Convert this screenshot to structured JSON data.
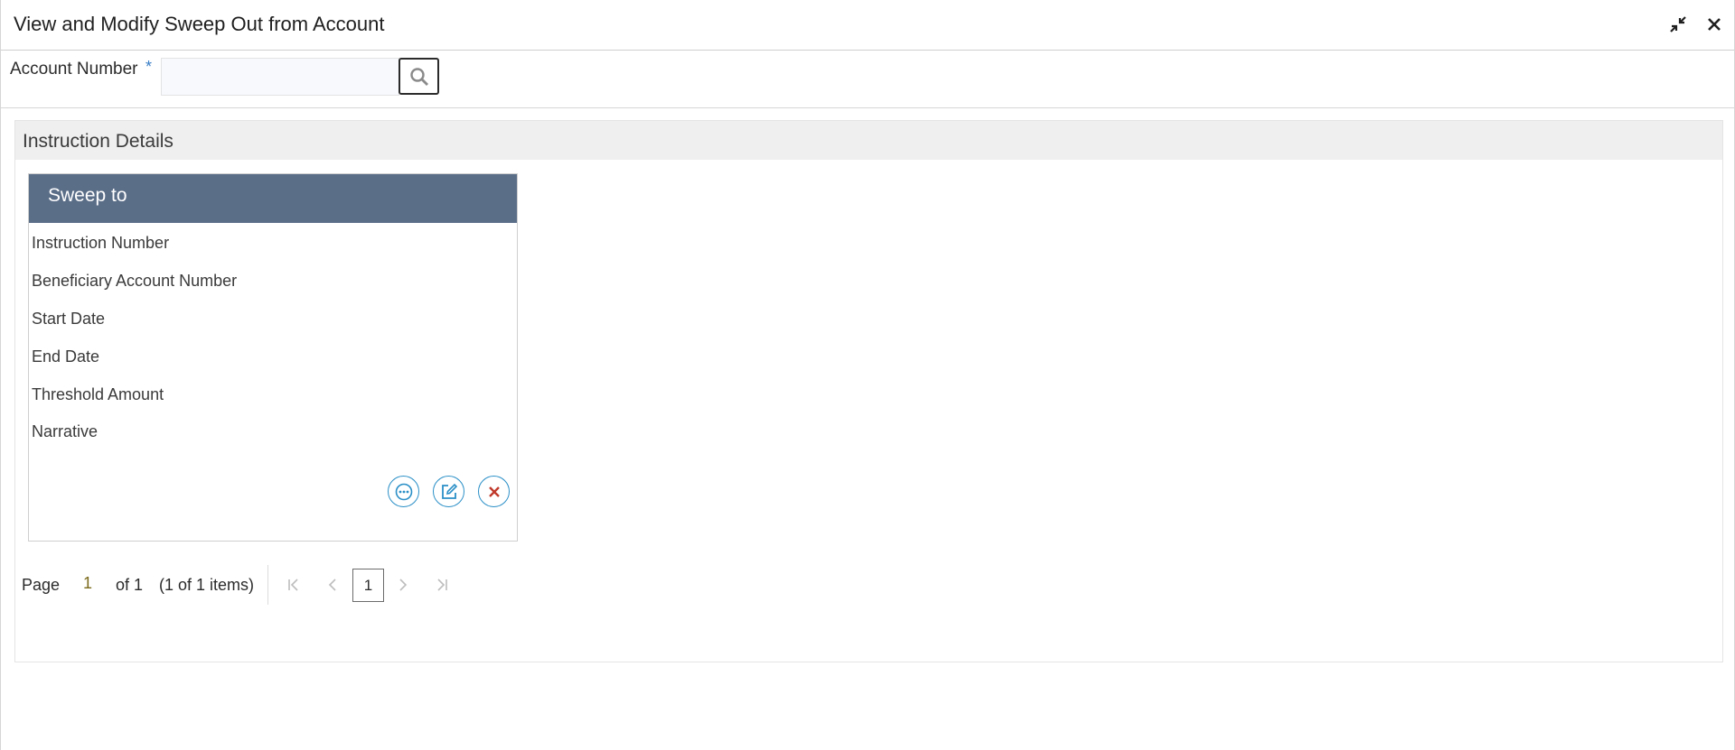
{
  "window": {
    "title": "View and Modify Sweep Out from Account",
    "minimize_icon": "collapse-arrows-icon",
    "close_icon": "close-icon"
  },
  "search": {
    "label": "Account Number",
    "required_marker": "*",
    "value": "",
    "placeholder": "",
    "button_icon": "search-icon"
  },
  "section": {
    "title": "Instruction Details"
  },
  "card": {
    "title": "Sweep to",
    "fields": [
      "Instruction Number",
      "Beneficiary Account Number",
      "Start Date",
      "End Date",
      "Threshold Amount",
      "Narrative"
    ],
    "actions": [
      {
        "name": "view",
        "icon": "more-dots-icon",
        "color": "#2a8fc7"
      },
      {
        "name": "edit",
        "icon": "edit-icon",
        "color": "#2a8fc7"
      },
      {
        "name": "delete",
        "icon": "close-x-icon",
        "color": "#c0392b"
      }
    ]
  },
  "pager": {
    "page_label": "Page",
    "current_page": "1",
    "of_label": "of 1",
    "items_label": "(1 of 1 items)",
    "page_button": "1"
  },
  "colors": {
    "card_header": "#5b6e88",
    "accent": "#2a8fc7",
    "section_header": "#efefef"
  }
}
